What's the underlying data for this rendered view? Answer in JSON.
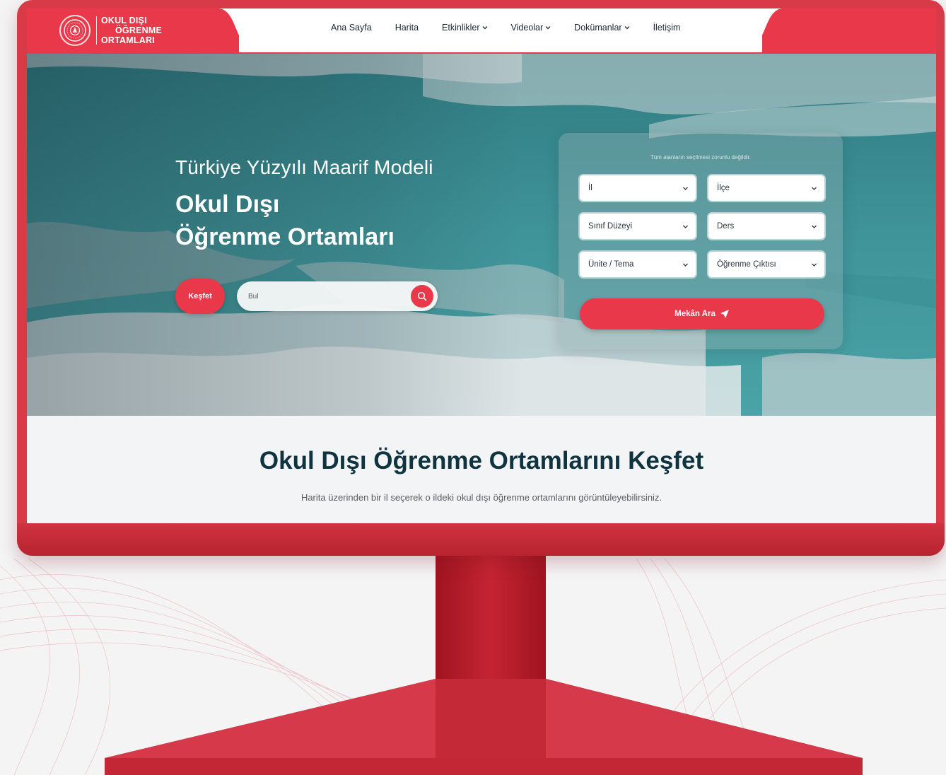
{
  "logo": {
    "line1": "OKUL DIŞI",
    "line2": "ÖĞRENME",
    "line3": "ORTAMLARI"
  },
  "nav": {
    "items": [
      {
        "label": "Ana Sayfa",
        "dropdown": false
      },
      {
        "label": "Harita",
        "dropdown": false
      },
      {
        "label": "Etkinlikler",
        "dropdown": true
      },
      {
        "label": "Videolar",
        "dropdown": true
      },
      {
        "label": "Dokümanlar",
        "dropdown": true
      },
      {
        "label": "İletişim",
        "dropdown": false
      }
    ]
  },
  "hero": {
    "subtitle": "Türkiye Yüzyılı Maarif Modeli",
    "title_line1": "Okul Dışı",
    "title_line2": "Öğrenme Ortamları",
    "explore_label": "Keşfet",
    "search_placeholder": "Bul"
  },
  "filter": {
    "note": "Tüm alanların seçilmesi zorunlu değildir.",
    "selects": {
      "il": "İl",
      "ilce": "İlçe",
      "sinif": "Sınıf Düzeyi",
      "ders": "Ders",
      "unite": "Ünite / Tema",
      "cikti": "Öğrenme Çıktısı"
    },
    "submit_label": "Mekân Ara"
  },
  "section": {
    "title": "Okul Dışı Öğrenme Ortamlarını Keşfet",
    "description": "Harita üzerinden bir il seçerek o ildeki okul dışı öğrenme ortamlarını görüntüleyebilirsiniz."
  },
  "colors": {
    "brand_red": "#e8384a",
    "frame_red": "#d93a48",
    "title_dark": "#0f3440",
    "water_teal": "#3f8e92"
  }
}
